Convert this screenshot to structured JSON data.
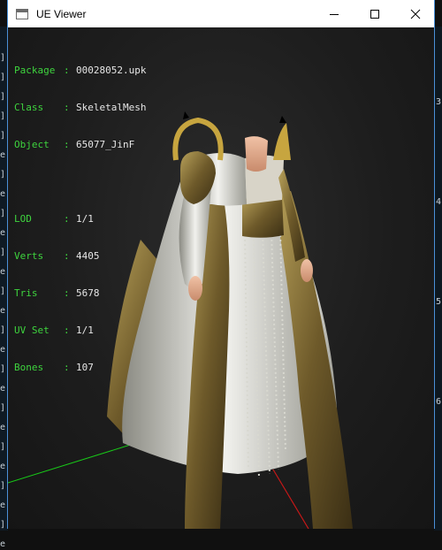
{
  "window": {
    "title": "UE Viewer",
    "controls": {
      "minimize": "minimize",
      "maximize": "maximize",
      "close": "close"
    }
  },
  "info": {
    "package": {
      "key": "Package",
      "value": "00028052.upk"
    },
    "class": {
      "key": "Class",
      "value": "SkeletalMesh"
    },
    "object": {
      "key": "Object",
      "value": "65077_JinF"
    },
    "lod": {
      "key": "LOD",
      "value": "1/1"
    },
    "verts": {
      "key": "Verts",
      "value": "4405"
    },
    "tris": {
      "key": "Tris",
      "value": "5678"
    },
    "uvset": {
      "key": "UV Set",
      "value": "1/1"
    },
    "bones": {
      "key": "Bones",
      "value": "107"
    },
    "separator": ":"
  },
  "background_window": {
    "left_glyphs": [
      "]",
      "]",
      "]",
      "]",
      "]",
      "e",
      "]",
      "e",
      "]",
      "e",
      "]",
      "e",
      "]",
      "e",
      "]",
      "e",
      "]",
      "e",
      "]",
      "e",
      "]",
      "e",
      "]",
      "e",
      "]",
      "e"
    ],
    "right_glyphs": [
      "3",
      "4",
      "5",
      "6"
    ]
  },
  "colors": {
    "info_key": "#3ed43e",
    "info_value": "#e6e6e6",
    "axis_x": "#c81818",
    "axis_z": "#18c818",
    "window_border": "#4a90d9"
  }
}
